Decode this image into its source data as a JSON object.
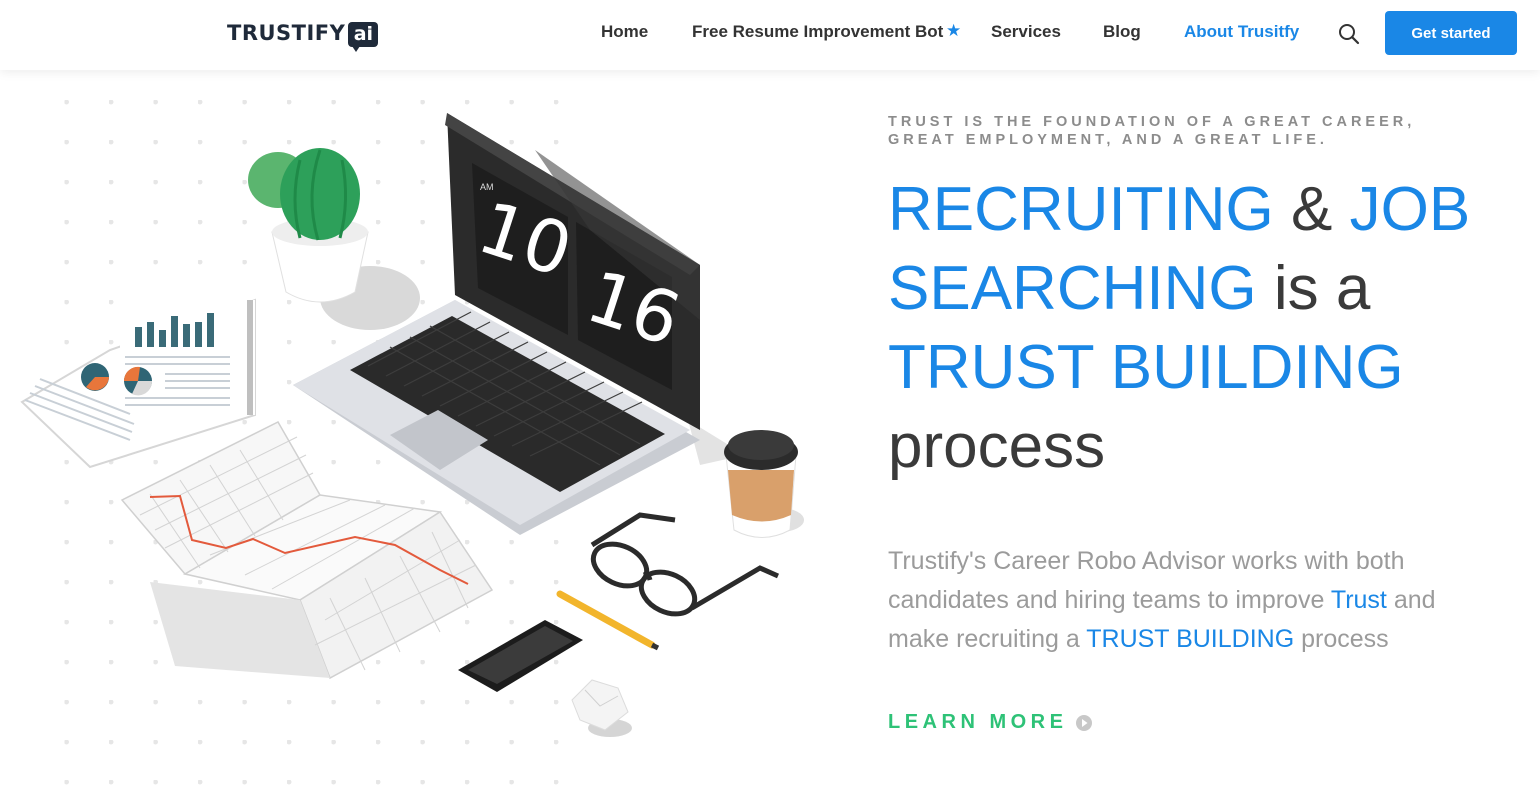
{
  "header": {
    "logo_text": "TRUSTIFY",
    "logo_badge": "ai",
    "nav": [
      {
        "label": "Home"
      },
      {
        "label": "Free Resume Improvement Bot"
      },
      {
        "label": "Services"
      },
      {
        "label": "Blog"
      },
      {
        "label": "About Trusitfy"
      }
    ],
    "star_glyph": "★",
    "cta_label": "Get started"
  },
  "hero": {
    "tagline": "TRUST IS THE FOUNDATION OF A GREAT CAREER, GREAT EMPLOYMENT, AND A GREAT LIFE.",
    "headline": {
      "w1": "RECRUITING",
      "amp": " & ",
      "w2": "JOB SEARCHING",
      "w3": " is a ",
      "w4": "TRUST BUILDING",
      "w5": " process"
    },
    "description": {
      "p1": "Trustify's Career Robo Advisor works with both candidates and hiring teams to improve ",
      "link1": "Trust",
      "p2": " and make recruiting a ",
      "link2": "TRUST BUILDING",
      "p3": " process"
    },
    "learn_more": "LEARN MORE"
  },
  "illustration": {
    "clock_ampm": "AM",
    "clock_hour": "10",
    "clock_minute": "16"
  },
  "colors": {
    "brand_blue": "#1a87e6",
    "learn_more_green": "#2ec277",
    "logo_dark": "#1f2a3a"
  },
  "icons": [
    "search-icon",
    "star-icon",
    "arrow-circle-icon"
  ]
}
